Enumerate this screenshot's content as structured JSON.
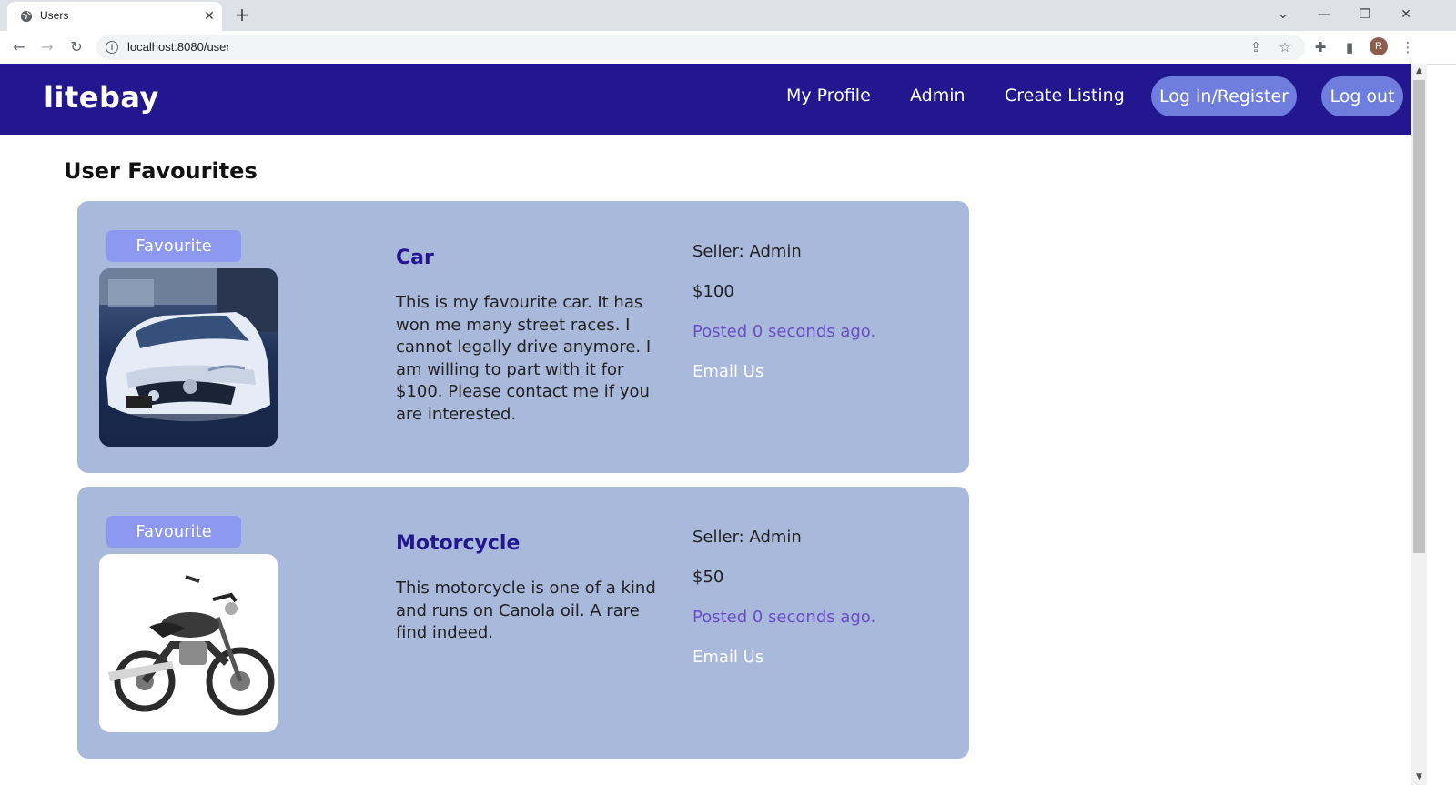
{
  "browser": {
    "tab_title": "Users",
    "url": "localhost:8080/user",
    "profile_initial": "R"
  },
  "colors": {
    "navbar": "#22178f",
    "card": "#a9b9dc",
    "pill": "#6f7ede",
    "favourite_button": "#8d98f0",
    "posted_text": "#6a4ec4"
  },
  "navbar": {
    "brand": "litebay",
    "links": {
      "my_profile": "My Profile",
      "admin": "Admin",
      "create_listing": "Create Listing"
    },
    "login_register": "Log in/Register",
    "logout": "Log out"
  },
  "page": {
    "title": "User Favourites"
  },
  "listings": [
    {
      "favourite_label": "Favourite",
      "image": "car-photo",
      "title": "Car",
      "description": "This is my favourite car. It has won me many street races. I cannot legally drive anymore. I am willing to part with it for $100. Please contact me if you are interested.",
      "seller": "Seller: Admin",
      "price": "$100",
      "posted": "Posted 0 seconds ago.",
      "email": "Email Us"
    },
    {
      "favourite_label": "Favourite",
      "image": "motorcycle-photo",
      "title": "Motorcycle",
      "description": "This motorcycle is one of a kind and runs on Canola oil. A rare find indeed.",
      "seller": "Seller: Admin",
      "price": "$50",
      "posted": "Posted 0 seconds ago.",
      "email": "Email Us"
    }
  ]
}
